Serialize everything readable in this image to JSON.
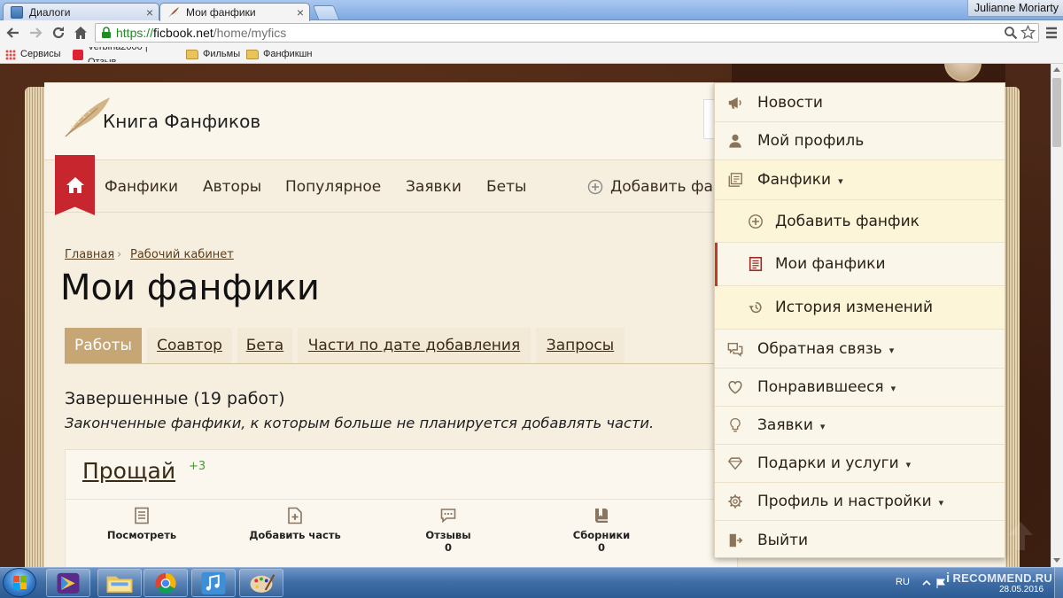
{
  "browser": {
    "tabs": [
      {
        "label": "Диалоги",
        "icon": "dialogs-favicon-icon"
      },
      {
        "label": "Мои фанфики",
        "icon": "ficbook-quill-favicon-icon",
        "active": true
      }
    ],
    "user": "Julianne Moriarty",
    "url": {
      "scheme": "https://",
      "host": "ficbook.net",
      "path": "/home/myfics"
    },
    "bookmarks": [
      {
        "label": "Сервисы",
        "icon": "apps-grid-icon"
      },
      {
        "label": "Verbina2000 | Отзыв",
        "icon": "site-favicon-icon"
      },
      {
        "label": "Фильмы",
        "icon": "folder-icon"
      },
      {
        "label": "Фанфикшн",
        "icon": "folder-icon"
      }
    ]
  },
  "site": {
    "logo_text": "Книга Фанфиков",
    "nav": [
      "Фанфики",
      "Авторы",
      "Популярное",
      "Заявки",
      "Беты"
    ],
    "add_fic": "Добавить фа"
  },
  "breadcrumb": [
    "Главная",
    "Рабочий кабинет"
  ],
  "page_title": "Мои фанфики",
  "tabs": [
    "Работы",
    "Соавтор",
    "Бета",
    "Части по дате добавления",
    "Запросы"
  ],
  "section": {
    "heading": "Завершенные (19 работ)",
    "subtitle": "Законченные фанфики, к которым больше не планируется добавлять части."
  },
  "fic": {
    "title": "Прощай",
    "badge": "+3",
    "actions": [
      {
        "label": "Посмотреть",
        "icon": "view-document-icon"
      },
      {
        "label": "Добавить часть",
        "icon": "add-part-icon"
      },
      {
        "label": "Отзывы",
        "count": "0",
        "icon": "reviews-icon"
      },
      {
        "label": "Сборники",
        "count": "0",
        "icon": "collections-icon"
      }
    ]
  },
  "menu": {
    "items": [
      {
        "label": "Новости",
        "icon": "megaphone-icon"
      },
      {
        "label": "Мой профиль",
        "icon": "user-icon"
      },
      {
        "label": "Фанфики",
        "icon": "fanfics-icon",
        "has_submenu": true,
        "expanded": true
      },
      {
        "label": "Добавить фанфик",
        "icon": "plus-circle-icon",
        "sub": true
      },
      {
        "label": "Мои фанфики",
        "icon": "document-list-icon",
        "sub": true,
        "active": true
      },
      {
        "label": "История изменений",
        "icon": "history-icon",
        "sub": true
      },
      {
        "label": "Обратная связь",
        "icon": "chat-icon",
        "has_submenu": true
      },
      {
        "label": "Понравившееся",
        "icon": "heart-icon",
        "has_submenu": true
      },
      {
        "label": "Заявки",
        "icon": "lightbulb-icon",
        "has_submenu": true
      },
      {
        "label": "Подарки и услуги",
        "icon": "diamond-icon",
        "has_submenu": true
      },
      {
        "label": "Профиль и настройки",
        "icon": "gear-icon",
        "has_submenu": true
      },
      {
        "label": "Выйти",
        "icon": "logout-icon"
      }
    ]
  },
  "taskbar": {
    "lang": "RU",
    "date": "28.05.2016",
    "pinned": [
      "media-player-icon",
      "explorer-icon",
      "chrome-icon",
      "music-app-icon",
      "paint-icon"
    ]
  },
  "watermark": "RECOMMEND.RU",
  "colors": {
    "accent_red": "#c8262e",
    "tab_active": "#c7a676",
    "page_bg": "#f6efe0",
    "leather": "#4b2817",
    "menu_bg": "#fbf6ea",
    "menu_highlight": "#fdf5d8",
    "badge_green": "#4a9a3a",
    "link": "#5a3d1c"
  }
}
